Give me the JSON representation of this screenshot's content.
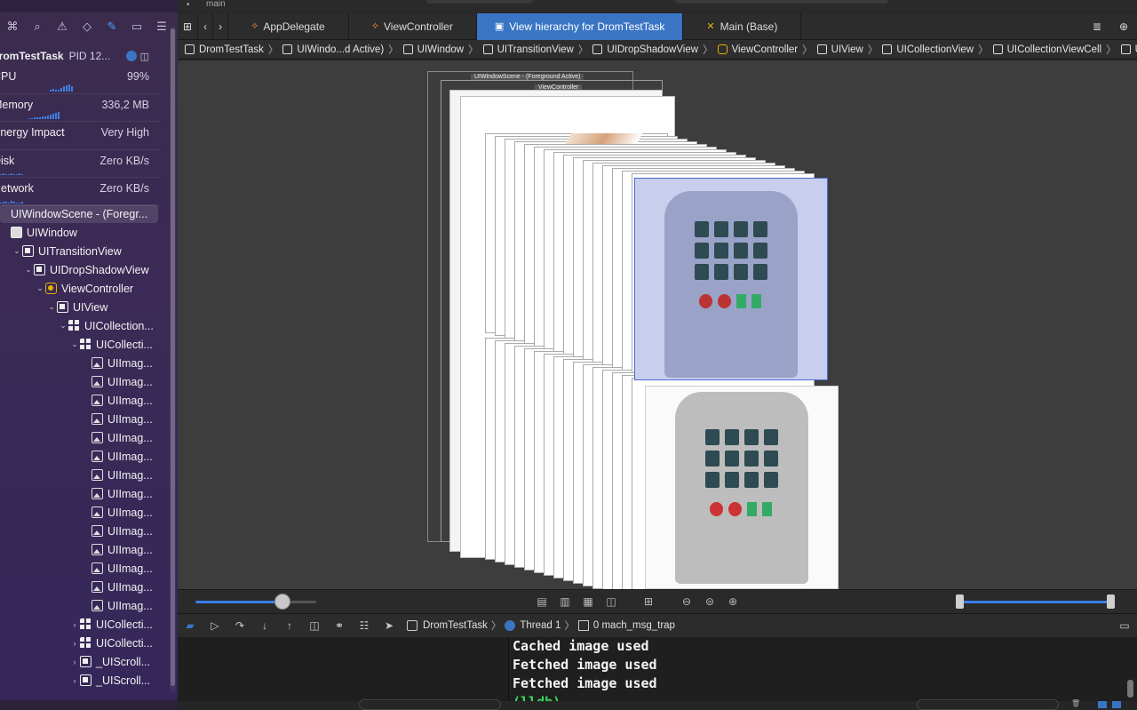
{
  "window": {
    "scheme_label": "main"
  },
  "sidebar": {
    "process_name": "DromTestTask",
    "pid_label": "PID 12...",
    "metrics": [
      {
        "label": "CPU",
        "value": "99%"
      },
      {
        "label": "Memory",
        "value": "336,2 MB"
      },
      {
        "label": "Energy Impact",
        "value": "Very High"
      },
      {
        "label": "Disk",
        "value": "Zero KB/s"
      },
      {
        "label": "Network",
        "value": "Zero KB/s"
      }
    ],
    "tree": [
      {
        "label": "UIWindowScene - (Foregr...",
        "depth": 0,
        "icon": "none",
        "chevron": "",
        "selected": true
      },
      {
        "label": "UIWindow",
        "depth": 0,
        "icon": "win",
        "chevron": ""
      },
      {
        "label": "UITransitionView",
        "depth": 1,
        "icon": "view",
        "chevron": "v"
      },
      {
        "label": "UIDropShadowView",
        "depth": 2,
        "icon": "view",
        "chevron": "v"
      },
      {
        "label": "ViewController",
        "depth": 3,
        "icon": "vc",
        "chevron": "v"
      },
      {
        "label": "UIView",
        "depth": 4,
        "icon": "view",
        "chevron": "v"
      },
      {
        "label": "UICollection...",
        "depth": 5,
        "icon": "grid",
        "chevron": "v"
      },
      {
        "label": "UICollecti...",
        "depth": 6,
        "icon": "grid",
        "chevron": "v"
      },
      {
        "label": "UIImag...",
        "depth": 7,
        "icon": "img",
        "chevron": ""
      },
      {
        "label": "UIImag...",
        "depth": 7,
        "icon": "img",
        "chevron": ""
      },
      {
        "label": "UIImag...",
        "depth": 7,
        "icon": "img",
        "chevron": ""
      },
      {
        "label": "UIImag...",
        "depth": 7,
        "icon": "img",
        "chevron": ""
      },
      {
        "label": "UIImag...",
        "depth": 7,
        "icon": "img",
        "chevron": ""
      },
      {
        "label": "UIImag...",
        "depth": 7,
        "icon": "img",
        "chevron": ""
      },
      {
        "label": "UIImag...",
        "depth": 7,
        "icon": "img",
        "chevron": ""
      },
      {
        "label": "UIImag...",
        "depth": 7,
        "icon": "img",
        "chevron": ""
      },
      {
        "label": "UIImag...",
        "depth": 7,
        "icon": "img",
        "chevron": ""
      },
      {
        "label": "UIImag...",
        "depth": 7,
        "icon": "img",
        "chevron": ""
      },
      {
        "label": "UIImag...",
        "depth": 7,
        "icon": "img",
        "chevron": ""
      },
      {
        "label": "UIImag...",
        "depth": 7,
        "icon": "img",
        "chevron": ""
      },
      {
        "label": "UIImag...",
        "depth": 7,
        "icon": "img",
        "chevron": ""
      },
      {
        "label": "UIImag...",
        "depth": 7,
        "icon": "img",
        "chevron": ""
      },
      {
        "label": "UICollecti...",
        "depth": 6,
        "icon": "grid",
        "chevron": ">"
      },
      {
        "label": "UICollecti...",
        "depth": 6,
        "icon": "grid",
        "chevron": ">"
      },
      {
        "label": "_UIScroll...",
        "depth": 6,
        "icon": "view",
        "chevron": ">"
      },
      {
        "label": "_UIScroll...",
        "depth": 6,
        "icon": "view",
        "chevron": ">"
      }
    ]
  },
  "tabs": [
    {
      "label": "AppDelegate",
      "icon": "swift",
      "active": false
    },
    {
      "label": "ViewController",
      "icon": "swift",
      "active": false
    },
    {
      "label": "View hierarchy for DromTestTask",
      "icon": "hierarchy",
      "active": true
    },
    {
      "label": "Main (Base)",
      "icon": "storyboard",
      "active": false
    }
  ],
  "breadcrumbs": [
    {
      "label": "DromTestTask",
      "icon": "app"
    },
    {
      "label": "UIWindo...d Active)",
      "icon": "scene"
    },
    {
      "label": "UIWindow",
      "icon": "view"
    },
    {
      "label": "UITransitionView",
      "icon": "view"
    },
    {
      "label": "UIDropShadowView",
      "icon": "view"
    },
    {
      "label": "ViewController",
      "icon": "vc"
    },
    {
      "label": "UIView",
      "icon": "view"
    },
    {
      "label": "UICollectionView",
      "icon": "grid"
    },
    {
      "label": "UICollectionViewCell",
      "icon": "grid"
    },
    {
      "label": "UIImageView",
      "icon": "img"
    }
  ],
  "canvas": {
    "scene_label": "UIWindowScene - (Foreground Active)",
    "vc_label": "ViewController"
  },
  "debug_bar": {
    "target": "DromTestTask",
    "thread": "Thread 1",
    "frame": "0 mach_msg_trap"
  },
  "console": {
    "lines": [
      "Cached image used",
      "Fetched image used",
      "Fetched image used"
    ],
    "prompt": "(lldb)"
  },
  "colors": {
    "accent": "#3a75c4",
    "selection_overlay": "#b8c4ff",
    "prompt": "#3dd65a"
  }
}
